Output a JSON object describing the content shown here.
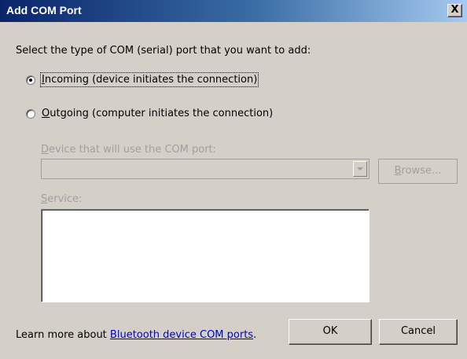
{
  "window": {
    "title": "Add COM Port",
    "close_glyph": "X"
  },
  "instruction": "Select the type of COM (serial) port that you want to add:",
  "options": {
    "incoming": {
      "accel": "I",
      "rest": "ncoming (device initiates the connection)",
      "checked": true
    },
    "outgoing": {
      "accel": "O",
      "rest": "utgoing (computer initiates the connection)",
      "checked": false
    }
  },
  "device": {
    "accel": "D",
    "rest": "evice that will use the COM port:",
    "value": "",
    "browse_accel": "B",
    "browse_rest": "rowse..."
  },
  "service": {
    "accel": "S",
    "rest": "ervice:"
  },
  "footer": {
    "learn_prefix": "Learn more about ",
    "learn_link": "Bluetooth device COM ports",
    "learn_suffix": ".",
    "ok_label": "OK",
    "cancel_label": "Cancel"
  }
}
